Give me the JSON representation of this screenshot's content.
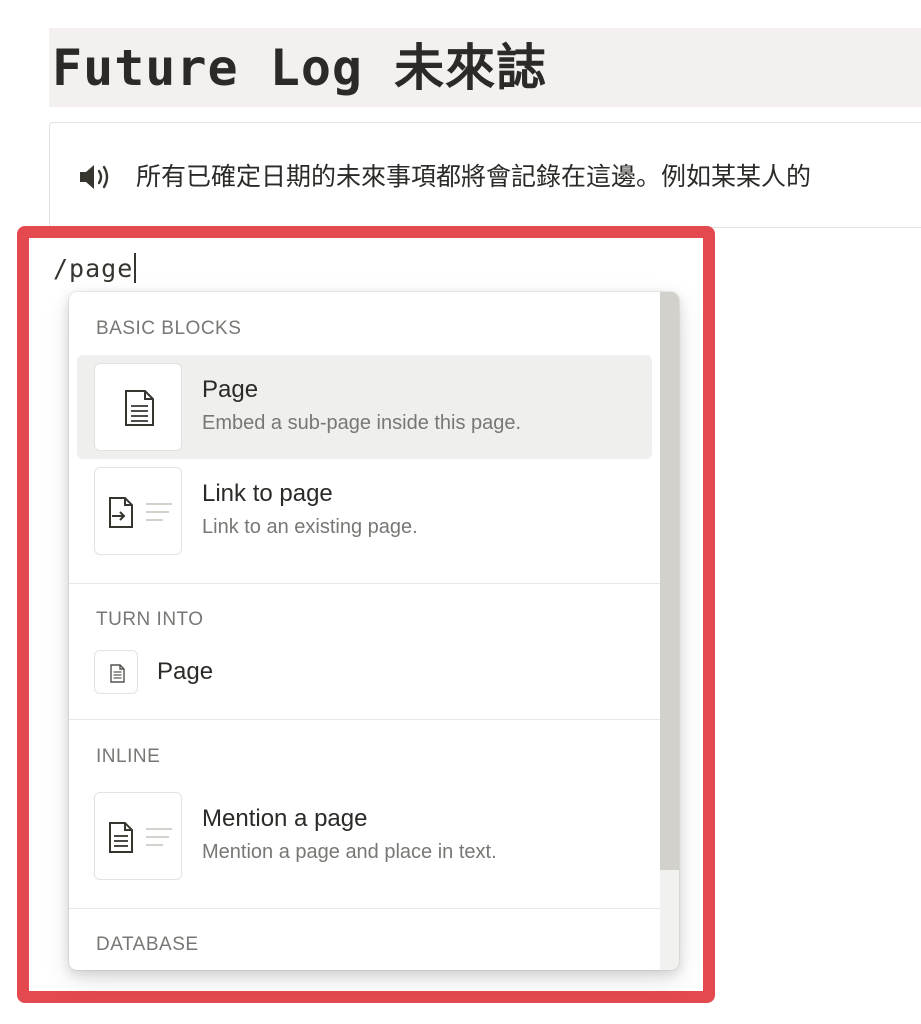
{
  "page": {
    "title": "Future Log 未來誌",
    "callout": {
      "icon": "speaker-icon",
      "text": "所有已確定日期的未來事項都將會記錄在這邊。例如某某人的"
    }
  },
  "editor": {
    "typed_command": "/page"
  },
  "menu": {
    "sections": [
      {
        "label": "BASIC BLOCKS",
        "items": [
          {
            "title": "Page",
            "description": "Embed a sub-page inside this page.",
            "icon": "page-icon",
            "selected": true
          },
          {
            "title": "Link to page",
            "description": "Link to an existing page.",
            "icon": "link-to-page-icon",
            "selected": false
          }
        ]
      },
      {
        "label": "TURN INTO",
        "items": [
          {
            "title": "Page",
            "icon": "page-icon"
          }
        ]
      },
      {
        "label": "INLINE",
        "items": [
          {
            "title": "Mention a page",
            "description": "Mention a page and place in text.",
            "icon": "mention-page-icon"
          }
        ]
      },
      {
        "label": "DATABASE",
        "items": []
      }
    ]
  },
  "colors": {
    "highlight_frame": "#e3494e",
    "title_background": "#f4f0ef",
    "selected_item_background": "#efefed"
  }
}
